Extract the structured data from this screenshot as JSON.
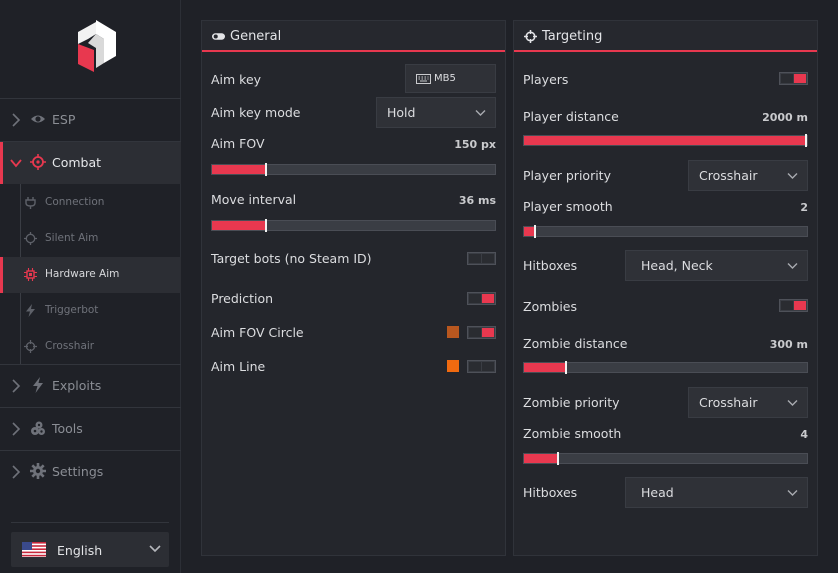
{
  "sidebar": {
    "nav": [
      {
        "label": "ESP",
        "icon": "eye-icon"
      },
      {
        "label": "Combat",
        "icon": "crosshair-icon"
      },
      {
        "label": "Exploits",
        "icon": "bolt-icon"
      },
      {
        "label": "Tools",
        "icon": "tools-icon"
      },
      {
        "label": "Settings",
        "icon": "gear-icon"
      }
    ],
    "sub": [
      {
        "label": "Connection",
        "icon": "plug-icon"
      },
      {
        "label": "Silent Aim",
        "icon": "target-icon"
      },
      {
        "label": "Hardware Aim",
        "icon": "chip-icon"
      },
      {
        "label": "Triggerbot",
        "icon": "bolt-icon"
      },
      {
        "label": "Crosshair",
        "icon": "crosshair-icon"
      }
    ],
    "language": "English"
  },
  "general": {
    "title": "General",
    "aim_key_label": "Aim key",
    "aim_key_value": "MB5",
    "aim_key_mode_label": "Aim key mode",
    "aim_key_mode_value": "Hold",
    "aim_fov_label": "Aim FOV",
    "aim_fov_value": "150 px",
    "aim_fov_fraction": 0.19,
    "move_interval_label": "Move interval",
    "move_interval_value": "36 ms",
    "move_interval_fraction": 0.19,
    "target_bots_label": "Target bots (no Steam ID)",
    "target_bots_on": false,
    "prediction_label": "Prediction",
    "prediction_on": true,
    "fov_circle_label": "Aim FOV Circle",
    "fov_circle_on": true,
    "fov_circle_color": "#b8571f",
    "aim_line_label": "Aim Line",
    "aim_line_on": false,
    "aim_line_color": "#f06a10"
  },
  "targeting": {
    "title": "Targeting",
    "players_label": "Players",
    "players_on": true,
    "player_distance_label": "Player distance",
    "player_distance_value": "2000 m",
    "player_distance_fraction": 1.0,
    "player_priority_label": "Player priority",
    "player_priority_value": "Crosshair",
    "player_smooth_label": "Player smooth",
    "player_smooth_value": "2",
    "player_smooth_fraction": 0.04,
    "player_hitboxes_label": "Hitboxes",
    "player_hitboxes_value": "Head, Neck",
    "zombies_label": "Zombies",
    "zombies_on": true,
    "zombie_distance_label": "Zombie distance",
    "zombie_distance_value": "300 m",
    "zombie_distance_fraction": 0.15,
    "zombie_priority_label": "Zombie priority",
    "zombie_priority_value": "Crosshair",
    "zombie_smooth_label": "Zombie smooth",
    "zombie_smooth_value": "4",
    "zombie_smooth_fraction": 0.12,
    "zombie_hitboxes_label": "Hitboxes",
    "zombie_hitboxes_value": "Head"
  },
  "colors": {
    "accent": "#e8384f",
    "background": "#1f2127",
    "panel": "#24262c"
  }
}
